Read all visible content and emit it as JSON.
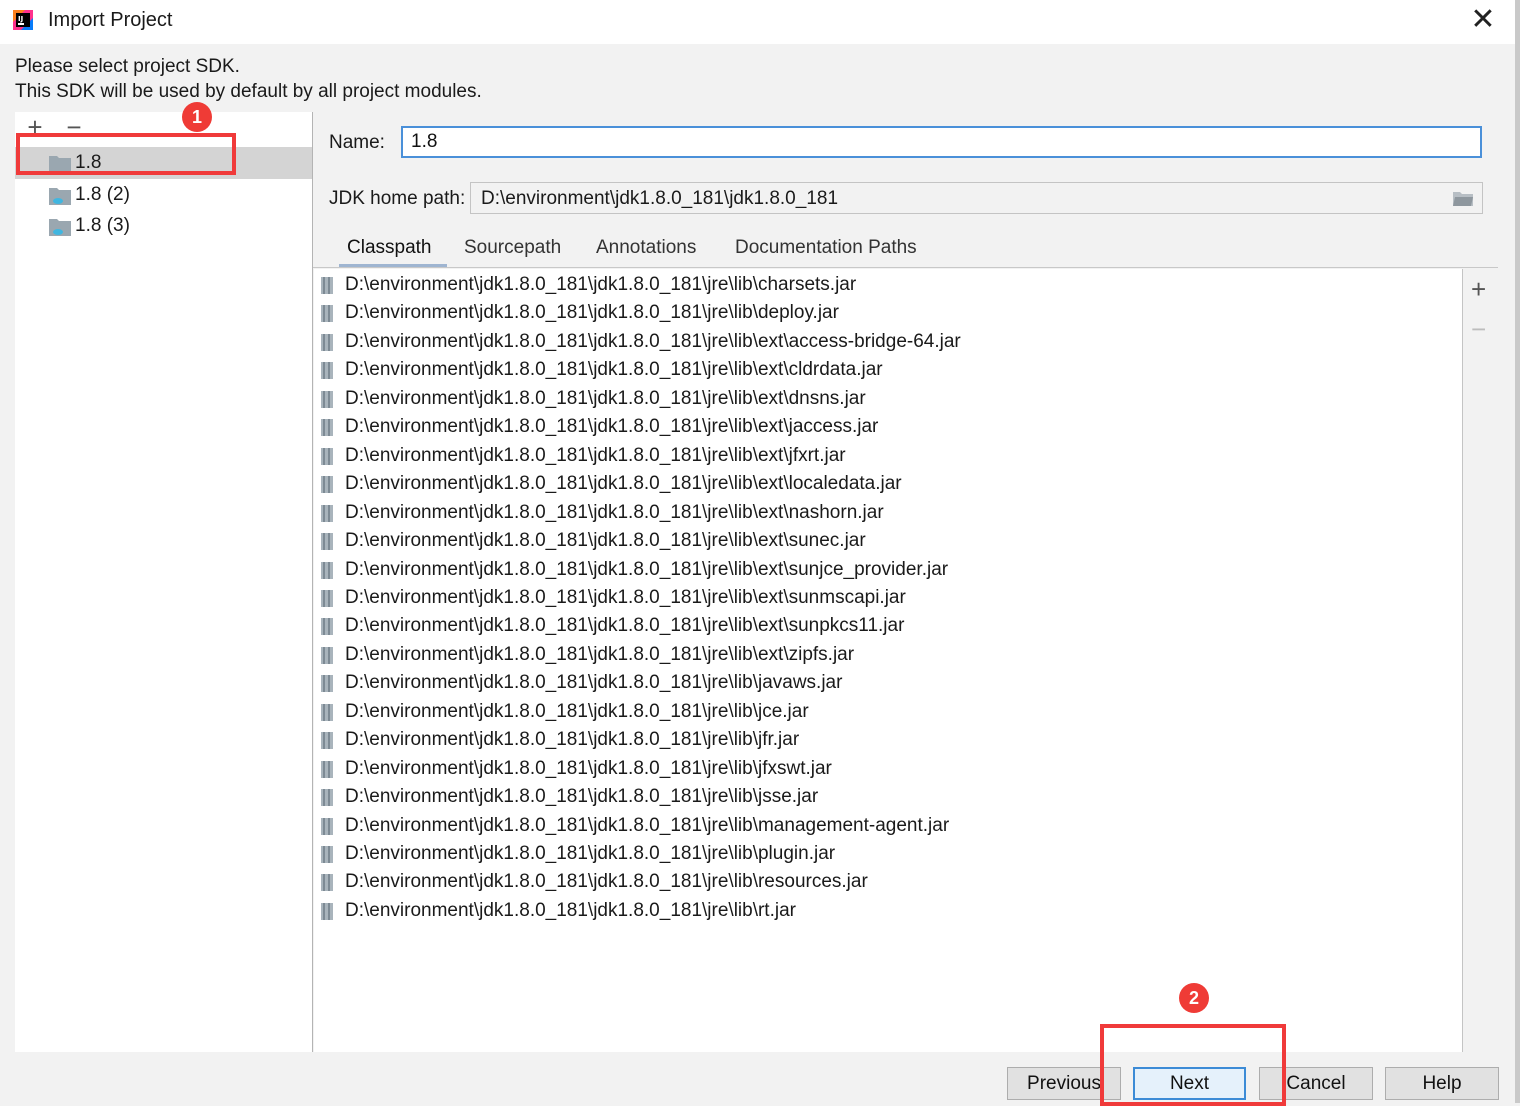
{
  "window": {
    "title": "Import Project",
    "close_symbol": "✕"
  },
  "intro": {
    "line1": "Please select project SDK.",
    "line2": "This SDK will be used by default by all project modules."
  },
  "sdk_toolbar": {
    "add": "+",
    "remove": "−"
  },
  "sdk_list": [
    {
      "label": "1.8",
      "selected": true
    },
    {
      "label": "1.8 (2)",
      "selected": false
    },
    {
      "label": "1.8 (3)",
      "selected": false
    }
  ],
  "form": {
    "name_label": "Name:",
    "name_value": "1.8",
    "jdk_label": "JDK home path:",
    "jdk_value": "D:\\environment\\jdk1.8.0_181\\jdk1.8.0_181"
  },
  "tabs": [
    {
      "label": "Classpath",
      "active": true
    },
    {
      "label": "Sourcepath",
      "active": false
    },
    {
      "label": "Annotations",
      "active": false
    },
    {
      "label": "Documentation Paths",
      "active": false
    }
  ],
  "classpath": [
    "D:\\environment\\jdk1.8.0_181\\jdk1.8.0_181\\jre\\lib\\charsets.jar",
    "D:\\environment\\jdk1.8.0_181\\jdk1.8.0_181\\jre\\lib\\deploy.jar",
    "D:\\environment\\jdk1.8.0_181\\jdk1.8.0_181\\jre\\lib\\ext\\access-bridge-64.jar",
    "D:\\environment\\jdk1.8.0_181\\jdk1.8.0_181\\jre\\lib\\ext\\cldrdata.jar",
    "D:\\environment\\jdk1.8.0_181\\jdk1.8.0_181\\jre\\lib\\ext\\dnsns.jar",
    "D:\\environment\\jdk1.8.0_181\\jdk1.8.0_181\\jre\\lib\\ext\\jaccess.jar",
    "D:\\environment\\jdk1.8.0_181\\jdk1.8.0_181\\jre\\lib\\ext\\jfxrt.jar",
    "D:\\environment\\jdk1.8.0_181\\jdk1.8.0_181\\jre\\lib\\ext\\localedata.jar",
    "D:\\environment\\jdk1.8.0_181\\jdk1.8.0_181\\jre\\lib\\ext\\nashorn.jar",
    "D:\\environment\\jdk1.8.0_181\\jdk1.8.0_181\\jre\\lib\\ext\\sunec.jar",
    "D:\\environment\\jdk1.8.0_181\\jdk1.8.0_181\\jre\\lib\\ext\\sunjce_provider.jar",
    "D:\\environment\\jdk1.8.0_181\\jdk1.8.0_181\\jre\\lib\\ext\\sunmscapi.jar",
    "D:\\environment\\jdk1.8.0_181\\jdk1.8.0_181\\jre\\lib\\ext\\sunpkcs11.jar",
    "D:\\environment\\jdk1.8.0_181\\jdk1.8.0_181\\jre\\lib\\ext\\zipfs.jar",
    "D:\\environment\\jdk1.8.0_181\\jdk1.8.0_181\\jre\\lib\\javaws.jar",
    "D:\\environment\\jdk1.8.0_181\\jdk1.8.0_181\\jre\\lib\\jce.jar",
    "D:\\environment\\jdk1.8.0_181\\jdk1.8.0_181\\jre\\lib\\jfr.jar",
    "D:\\environment\\jdk1.8.0_181\\jdk1.8.0_181\\jre\\lib\\jfxswt.jar",
    "D:\\environment\\jdk1.8.0_181\\jdk1.8.0_181\\jre\\lib\\jsse.jar",
    "D:\\environment\\jdk1.8.0_181\\jdk1.8.0_181\\jre\\lib\\management-agent.jar",
    "D:\\environment\\jdk1.8.0_181\\jdk1.8.0_181\\jre\\lib\\plugin.jar",
    "D:\\environment\\jdk1.8.0_181\\jdk1.8.0_181\\jre\\lib\\resources.jar",
    "D:\\environment\\jdk1.8.0_181\\jdk1.8.0_181\\jre\\lib\\rt.jar"
  ],
  "side_toolbar": {
    "add": "+",
    "remove": "−"
  },
  "buttons": {
    "previous": "Previous",
    "next": "Next",
    "cancel": "Cancel",
    "help": "Help"
  },
  "annotations": {
    "badge1": "1",
    "badge2": "2"
  },
  "colors": {
    "accent": "#4a90d9",
    "annotation": "#f03a3a",
    "selection": "#d4d4d4"
  }
}
